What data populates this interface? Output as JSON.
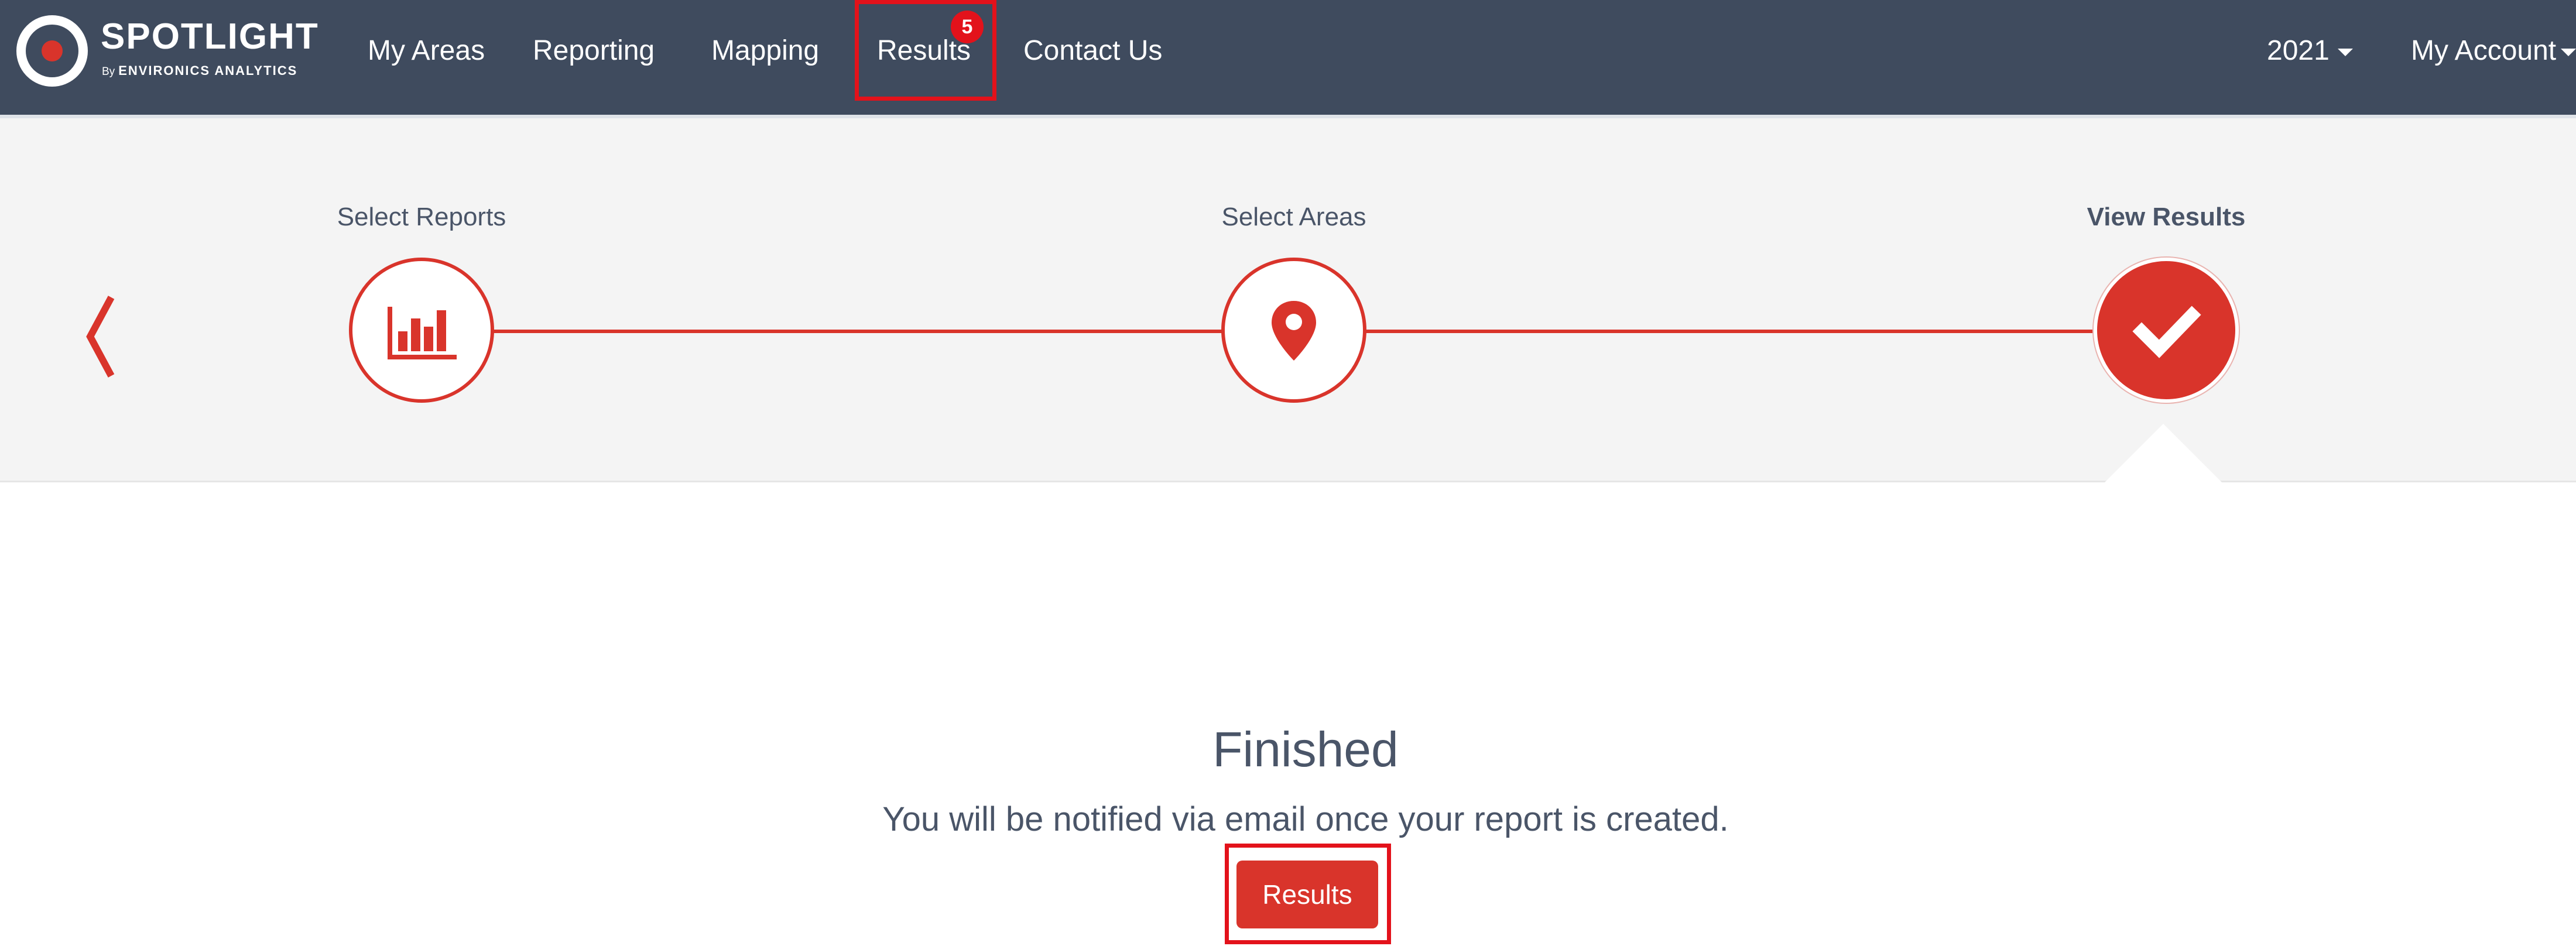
{
  "brand": {
    "name": "SPOTLIGHT",
    "by": "By",
    "company": "ENVIRONICS ANALYTICS"
  },
  "nav": {
    "items": [
      {
        "label": "My Areas"
      },
      {
        "label": "Reporting"
      },
      {
        "label": "Mapping"
      },
      {
        "label": "Results",
        "badge": "5"
      },
      {
        "label": "Contact Us"
      }
    ],
    "year": "2021",
    "account": "My Account"
  },
  "stepper": {
    "steps": [
      {
        "label": "Select Reports",
        "icon": "bar-chart-icon",
        "state": "complete"
      },
      {
        "label": "Select Areas",
        "icon": "map-pin-icon",
        "state": "complete"
      },
      {
        "label": "View Results",
        "icon": "check-icon",
        "state": "active"
      }
    ]
  },
  "finished": {
    "title": "Finished",
    "message": "You will be notified via email once your report is created.",
    "button_label": "Results"
  },
  "colors": {
    "navbar": "#3f4b5e",
    "accent": "#d9342b",
    "highlight": "#e3121b",
    "band": "#f4f4f4",
    "text": "#4a5568"
  }
}
